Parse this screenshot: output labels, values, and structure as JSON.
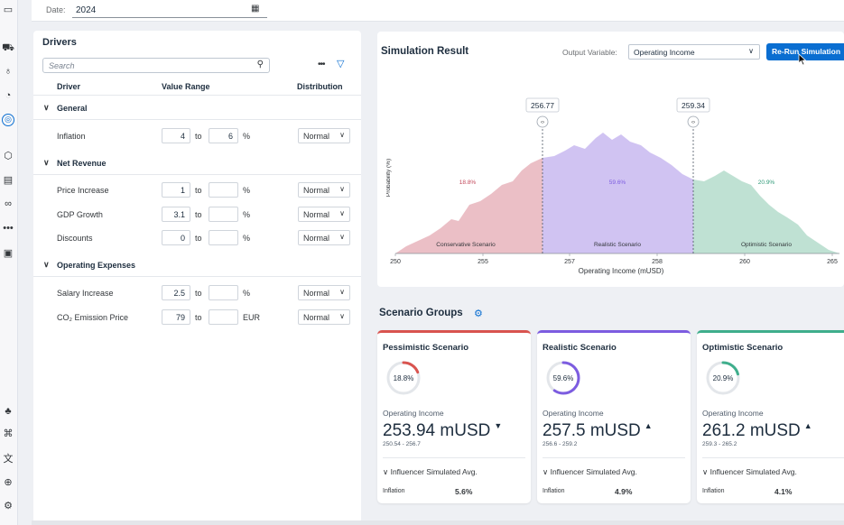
{
  "rail": {
    "icons": [
      "folder-icon",
      "car-icon",
      "bulb-icon",
      "shapes-icon",
      "compass-icon",
      "cube-icon",
      "building-icon",
      "binoculars-icon",
      "more-icon",
      "calendar-icon",
      "hierarchy-icon",
      "map-icon",
      "translate-icon",
      "lock-icon",
      "settings-icon"
    ]
  },
  "date": {
    "label": "Date:",
    "value": "2024"
  },
  "drivers": {
    "title": "Drivers",
    "search_placeholder": "Search",
    "columns": {
      "driver": "Driver",
      "range": "Value Range",
      "distribution": "Distribution"
    },
    "to_label": "to",
    "groups": [
      {
        "name": "General",
        "items": [
          {
            "name": "Inflation",
            "from": "4",
            "to": "6",
            "unit": "%",
            "dist": "Normal"
          }
        ]
      },
      {
        "name": "Net Revenue",
        "items": [
          {
            "name": "Price Increase",
            "from": "1",
            "to": "",
            "unit": "%",
            "dist": "Normal"
          },
          {
            "name": "GDP Growth",
            "from": "3.1",
            "to": "",
            "unit": "%",
            "dist": "Normal"
          },
          {
            "name": "Discounts",
            "from": "0",
            "to": "",
            "unit": "%",
            "dist": "Normal"
          }
        ]
      },
      {
        "name": "Operating Expenses",
        "items": [
          {
            "name": "Salary Increase",
            "from": "2.5",
            "to": "",
            "unit": "%",
            "dist": "Normal"
          },
          {
            "name": "CO₂ Emission Price",
            "from": "79",
            "to": "",
            "unit": "EUR",
            "dist": "Normal"
          }
        ]
      }
    ]
  },
  "simulation": {
    "title": "Simulation Result",
    "output_label": "Output Variable:",
    "output_value": "Operating Income",
    "rerun_label": "Re-Run Simulation"
  },
  "chart_data": {
    "type": "area",
    "xlabel": "Operating Income (mUSD)",
    "ylabel": "Probability (%)",
    "xlim": [
      250,
      265
    ],
    "x_ticks": [
      "250",
      "255",
      "257",
      "258",
      "260",
      "265"
    ],
    "thresholds": [
      256.77,
      259.34
    ],
    "threshold_labels": [
      "256.77",
      "259.34"
    ],
    "regions": [
      {
        "name": "Conservative Scenario",
        "percent_label": "18.8%",
        "color": "#e8b4bc"
      },
      {
        "name": "Realistic Scenario",
        "percent_label": "59.6%",
        "color": "#c8b8f0"
      },
      {
        "name": "Optimistic Scenario",
        "percent_label": "20.9%",
        "color": "#b4dccb"
      }
    ]
  },
  "scenario_groups": {
    "title": "Scenario Groups",
    "cards": [
      {
        "title": "Pessimistic Scenario",
        "percent": "18.8%",
        "fraction": 0.188,
        "color": "#d9544f",
        "metric": "Operating Income",
        "value": "253.94 mUSD",
        "trend": "down",
        "range": "250.54 - 256.7",
        "influencer_label": "Influencer Simulated Avg.",
        "influencer_name": "Inflation",
        "influencer_value": "5.6%"
      },
      {
        "title": "Realistic Scenario",
        "percent": "59.6%",
        "fraction": 0.596,
        "color": "#7c5ce0",
        "metric": "Operating Income",
        "value": "257.5 mUSD",
        "trend": "up",
        "range": "256.6 - 259.2",
        "influencer_label": "Influencer Simulated Avg.",
        "influencer_name": "Inflation",
        "influencer_value": "4.9%"
      },
      {
        "title": "Optimistic Scenario",
        "percent": "20.9%",
        "fraction": 0.209,
        "color": "#3fae8c",
        "metric": "Operating Income",
        "value": "261.2 mUSD",
        "trend": "up",
        "range": "259.3 - 265.2",
        "influencer_label": "Influencer Simulated Avg.",
        "influencer_name": "Inflation",
        "influencer_value": "4.1%"
      }
    ]
  }
}
